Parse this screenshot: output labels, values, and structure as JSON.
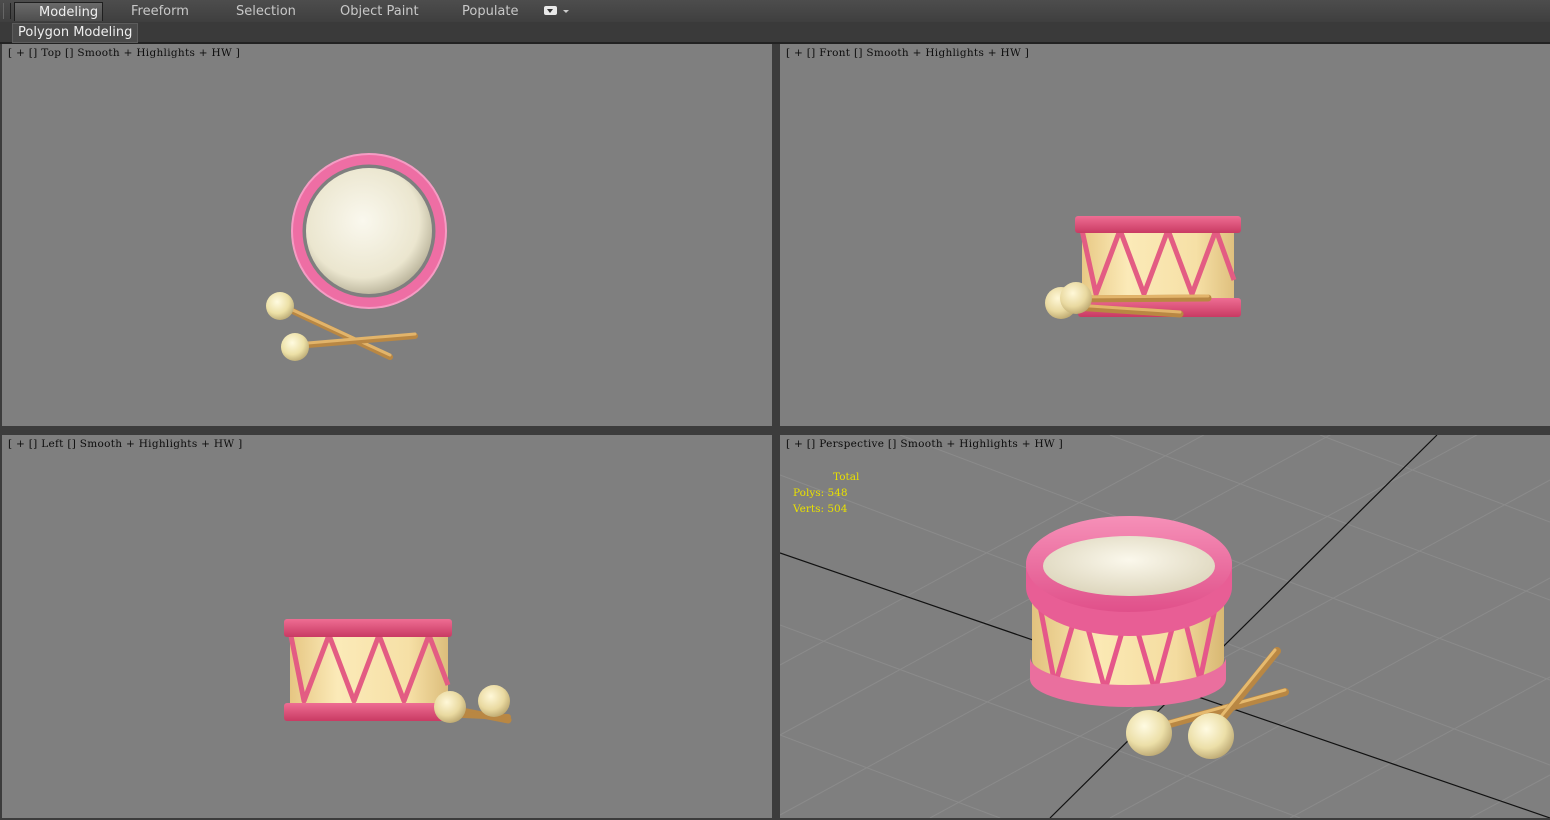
{
  "ribbon": {
    "tabs": [
      {
        "label": "Modeling",
        "active": true
      },
      {
        "label": "Freeform",
        "active": false
      },
      {
        "label": "Selection",
        "active": false
      },
      {
        "label": "Object Paint",
        "active": false
      },
      {
        "label": "Populate",
        "active": false
      }
    ],
    "panel_button": "Polygon Modeling"
  },
  "viewports": {
    "top": {
      "label": "[ + [] Top [] Smooth + Highlights + HW ]"
    },
    "front": {
      "label": "[ + [] Front [] Smooth + Highlights + HW ]"
    },
    "left": {
      "label": "[ + [] Left [] Smooth + Highlights + HW ]"
    },
    "perspective": {
      "label": "[ + [] Perspective [] Smooth + Highlights + HW ]",
      "stats": {
        "total": "Total",
        "polys": "Polys: 548",
        "verts": "Verts: 504"
      }
    }
  },
  "colors": {
    "viewport_bg": "#7f7f7f",
    "drum_pink": "#e0507c",
    "drum_body": "#f3dc9c",
    "drum_head": "#f2efe0",
    "stick": "#d8a85a",
    "stats_text": "#e8e000"
  }
}
